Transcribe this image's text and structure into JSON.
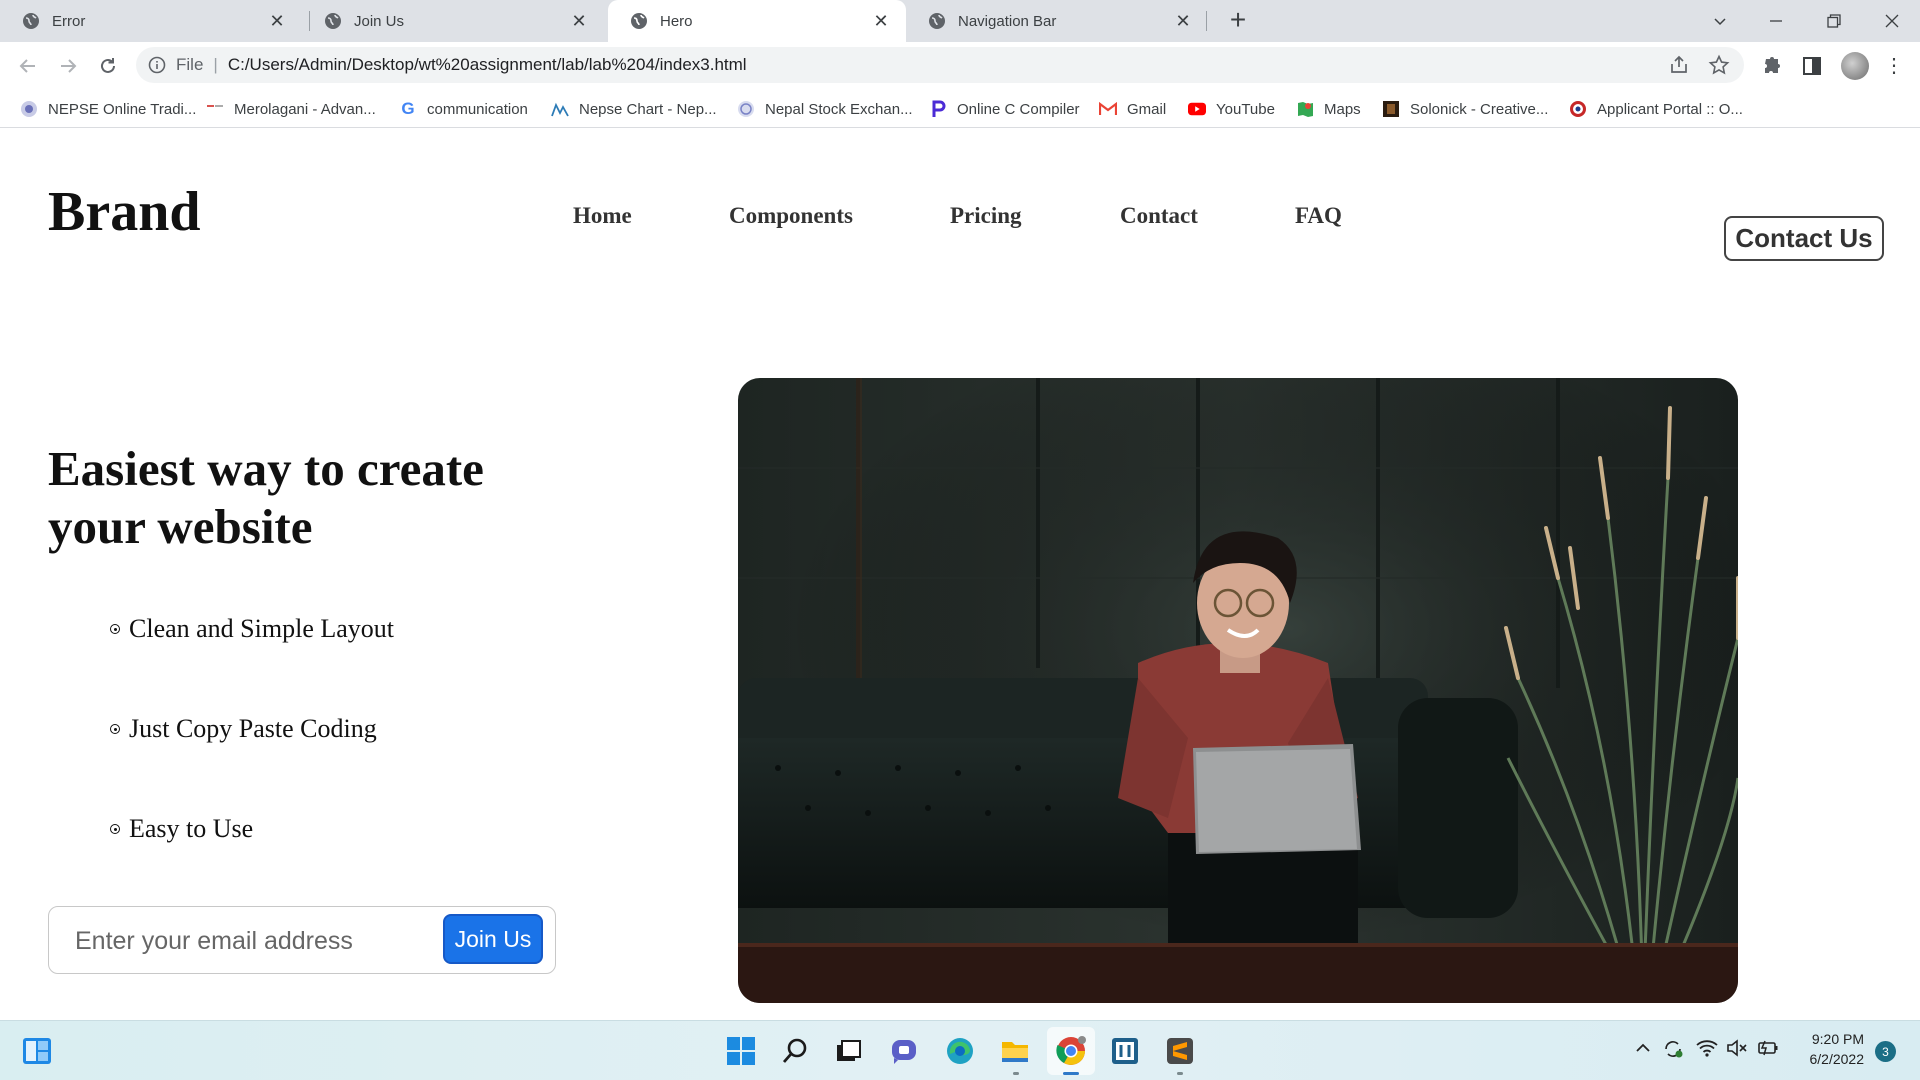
{
  "browser": {
    "tabs": [
      {
        "title": "Error",
        "active": false
      },
      {
        "title": "Join Us",
        "active": false
      },
      {
        "title": "Hero",
        "active": true
      },
      {
        "title": "Navigation Bar",
        "active": false
      }
    ],
    "address": {
      "scheme_label": "File",
      "url": "C:/Users/Admin/Desktop/wt%20assignment/lab/lab%204/index3.html"
    },
    "bookmarks": [
      {
        "label": "NEPSE Online Tradi...",
        "icon": "nepse-icon"
      },
      {
        "label": "Merolagani - Advan...",
        "icon": "merolagani-icon"
      },
      {
        "label": "communication",
        "icon": "google-icon"
      },
      {
        "label": "Nepse Chart - Nep...",
        "icon": "nepse-chart-icon"
      },
      {
        "label": "Nepal Stock Exchan...",
        "icon": "nepal-stock-icon"
      },
      {
        "label": "Online C Compiler",
        "icon": "programiz-icon"
      },
      {
        "label": "Gmail",
        "icon": "gmail-icon"
      },
      {
        "label": "YouTube",
        "icon": "youtube-icon"
      },
      {
        "label": "Maps",
        "icon": "maps-icon"
      },
      {
        "label": "Solonick - Creative...",
        "icon": "solonick-icon"
      },
      {
        "label": "Applicant Portal :: O...",
        "icon": "applicant-portal-icon"
      }
    ]
  },
  "site": {
    "brand": "Brand",
    "nav": [
      "Home",
      "Components",
      "Pricing",
      "Contact",
      "FAQ"
    ],
    "contact_button": "Contact Us",
    "hero": {
      "title": "Easiest way to create your website",
      "features": [
        "Clean and Simple Layout",
        "Just Copy Paste Coding",
        "Easy to Use"
      ],
      "email_placeholder": "Enter your email address",
      "join_button": "Join Us",
      "image_alt": "woman-with-laptop-on-leather-sofa"
    }
  },
  "taskbar": {
    "time": "9:20 PM",
    "date": "6/2/2022",
    "notification_count": "3"
  },
  "colors": {
    "tabstrip": "#dee1e6",
    "join_button": "#1a73e8",
    "taskbar": "#dcedf1"
  }
}
